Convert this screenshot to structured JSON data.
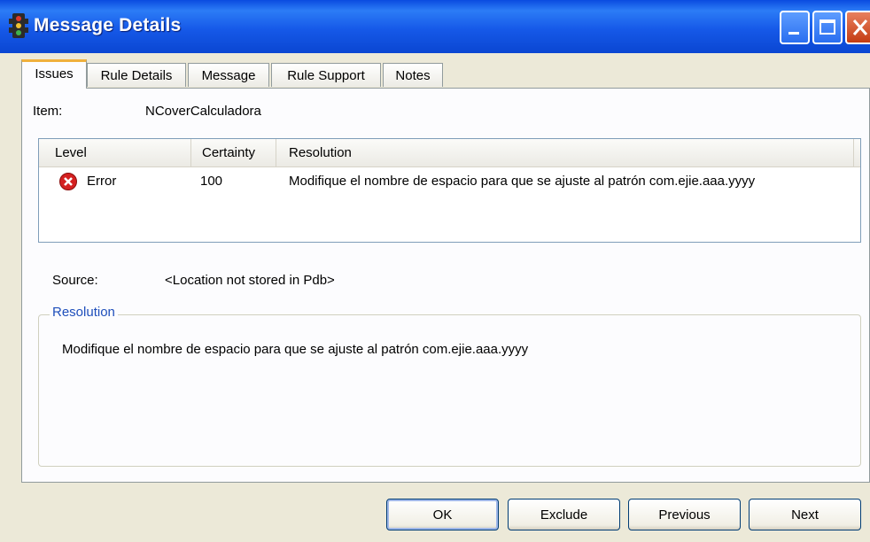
{
  "window": {
    "title": "Message Details"
  },
  "tabs": [
    {
      "label": "Issues"
    },
    {
      "label": "Rule Details"
    },
    {
      "label": "Message"
    },
    {
      "label": "Rule Support"
    },
    {
      "label": "Notes"
    }
  ],
  "item": {
    "label": "Item:",
    "value": "NCoverCalculadora"
  },
  "table": {
    "columns": [
      "Level",
      "Certainty",
      "Resolution"
    ],
    "rows": [
      {
        "level_icon": "error-icon",
        "level": "Error",
        "certainty": "100",
        "resolution": "Modifique el nombre de espacio para que se ajuste al patrón com.ejie.aaa.yyyy"
      }
    ]
  },
  "source": {
    "label": "Source:",
    "value": "<Location not stored in Pdb>"
  },
  "resolution_group": {
    "title": "Resolution",
    "text": "Modifique el nombre de espacio para que se ajuste al patrón com.ejie.aaa.yyyy"
  },
  "buttons": {
    "ok": "OK",
    "exclude": "Exclude",
    "previous": "Previous",
    "next": "Next"
  },
  "colors": {
    "titlebar": "#0a4be0",
    "tab_highlight": "#f0b03c",
    "dialog_bg": "#ece9d8",
    "error_red": "#d42020",
    "group_title": "#1f4fbb"
  }
}
